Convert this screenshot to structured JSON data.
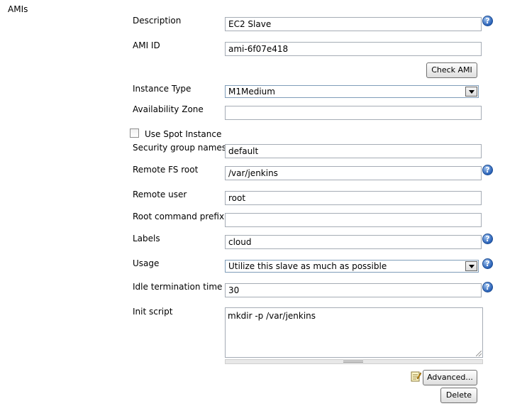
{
  "section": {
    "title": "AMIs"
  },
  "fields": {
    "description": {
      "label": "Description",
      "value": "EC2 Slave"
    },
    "ami_id": {
      "label": "AMI ID",
      "value": "ami-6f07e418"
    },
    "instance_type": {
      "label": "Instance Type",
      "value": "M1Medium"
    },
    "availability_zone": {
      "label": "Availability Zone",
      "value": ""
    },
    "spot": {
      "label": "Use Spot Instance",
      "checked": false
    },
    "security_groups": {
      "label": "Security group names",
      "value": "default"
    },
    "remote_fs_root": {
      "label": "Remote FS root",
      "value": "/var/jenkins"
    },
    "remote_user": {
      "label": "Remote user",
      "value": "root"
    },
    "root_command_prefix": {
      "label": "Root command prefix",
      "value": ""
    },
    "labels": {
      "label": "Labels",
      "value": "cloud"
    },
    "usage": {
      "label": "Usage",
      "value": "Utilize this slave as much as possible"
    },
    "idle_termination": {
      "label": "Idle termination time",
      "value": "30"
    },
    "init_script": {
      "label": "Init script",
      "value": "mkdir -p /var/jenkins"
    }
  },
  "buttons": {
    "check_ami": "Check AMI",
    "advanced": "Advanced...",
    "delete": "Delete"
  },
  "help_glyph": "?",
  "icons": {
    "help": "help-icon",
    "notepad": "notepad-icon",
    "dropdown": "chevron-down-icon"
  }
}
